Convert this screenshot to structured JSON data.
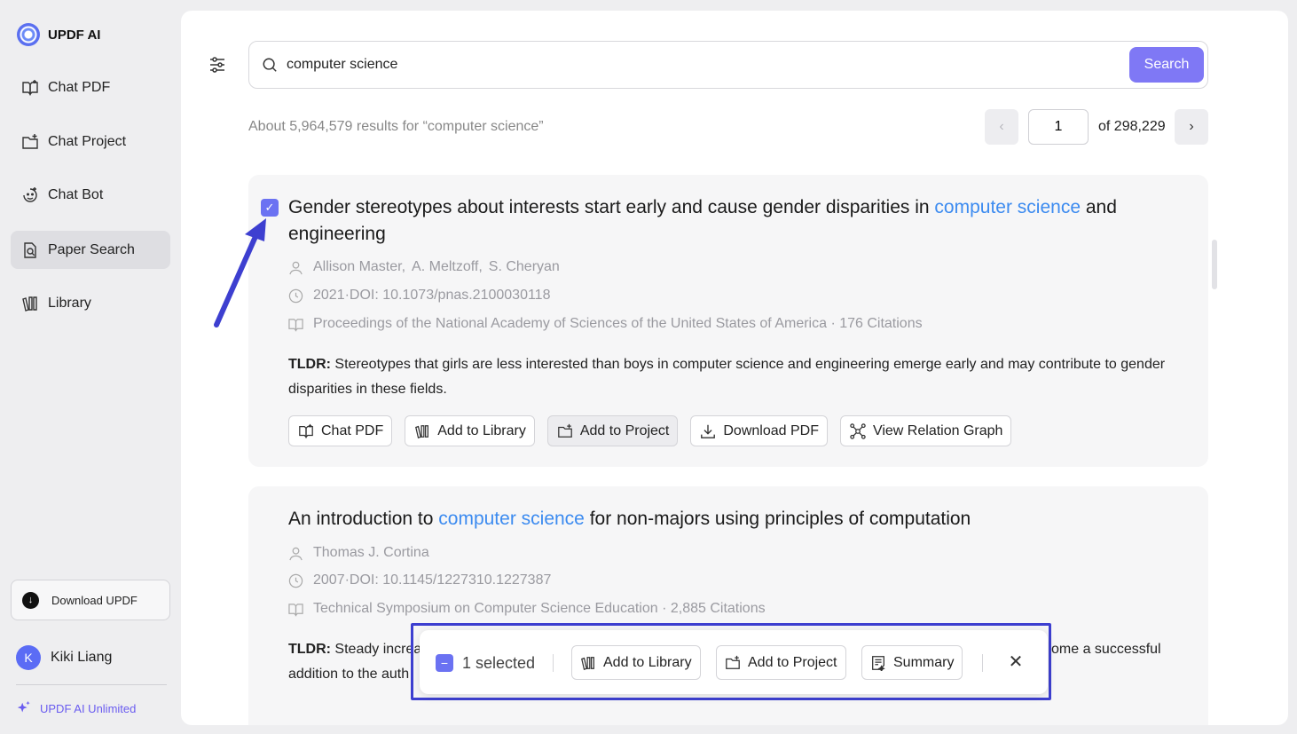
{
  "app": {
    "name": "UPDF AI"
  },
  "sidebar": {
    "items": [
      {
        "label": "Chat PDF"
      },
      {
        "label": "Chat Project"
      },
      {
        "label": "Chat Bot"
      },
      {
        "label": "Paper Search"
      },
      {
        "label": "Library"
      }
    ],
    "active_item": "Paper Search",
    "download_label": "Download UPDF",
    "user_name": "Kiki Liang",
    "user_initial": "K",
    "plan_label": "UPDF AI Unlimited"
  },
  "search": {
    "query": "computer science",
    "button_label": "Search"
  },
  "results": {
    "summary": "About 5,964,579 results for “computer science”",
    "page_current": "1",
    "page_total_label": "of 298,229"
  },
  "papers": [
    {
      "selected": true,
      "title_before": "Gender stereotypes about interests start early and cause gender disparities in ",
      "title_highlight": "computer science",
      "title_after": " and engineering",
      "authors": [
        "Allison Master,",
        "A. Meltzoff,",
        "S. Cheryan"
      ],
      "date_doi": "2021·DOI: 10.1073/pnas.2100030118",
      "venue": "Proceedings of the National Academy of Sciences of the United States of America · 176 Citations",
      "tldr_label": "TLDR:",
      "tldr": " Stereotypes that girls are less interested than boys in computer science and engineering emerge early and may contribute to gender disparities in these fields.",
      "actions": [
        "Chat PDF",
        "Add to Library",
        "Add to Project",
        "Download PDF",
        "View Relation Graph"
      ]
    },
    {
      "selected": false,
      "title_before": "An introduction to ",
      "title_highlight": "computer science",
      "title_after": " for non-majors using principles of computation",
      "authors": [
        "Thomas J. Cortina"
      ],
      "date_doi": "2007·DOI: 10.1145/1227310.1227387",
      "venue": "Technical Symposium on Computer Science Education · 2,885 Citations",
      "tldr_label": "TLDR:",
      "tldr_visible_start": " Steady increa",
      "tldr_visible_end": "ome a successful",
      "tldr_line2": "addition to the auth"
    }
  ],
  "bulk_bar": {
    "count_label": "1 selected",
    "add_library": "Add to Library",
    "add_project": "Add to Project",
    "summary": "Summary"
  },
  "colors": {
    "accent": "#7f78f5",
    "highlight": "#3c8bf0",
    "annotation": "#3d3fd0"
  }
}
